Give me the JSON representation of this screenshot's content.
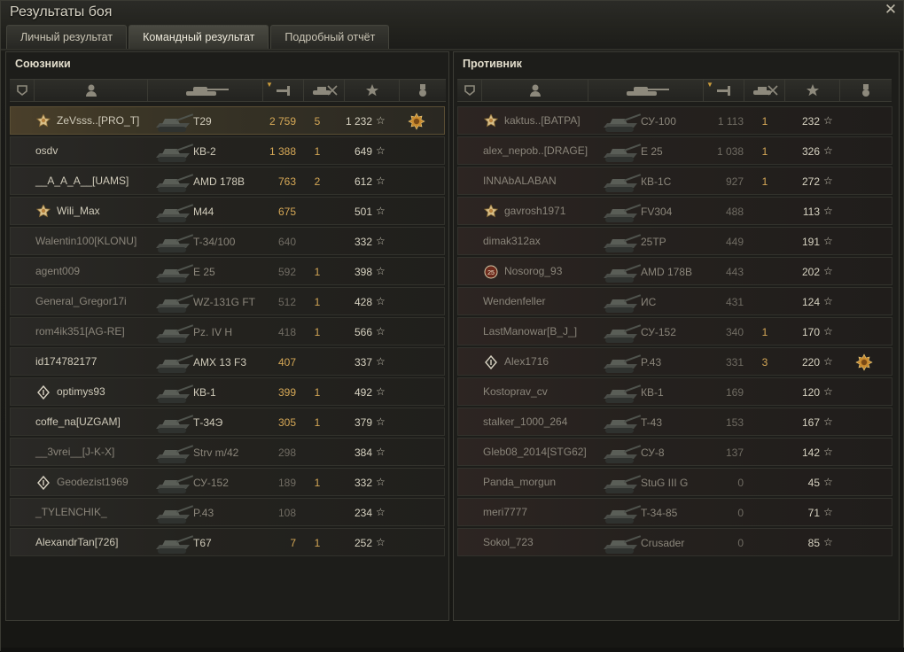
{
  "window": {
    "title": "Результаты боя",
    "close_icon": "close-icon"
  },
  "tabs": [
    {
      "label": "Личный результат",
      "active": false
    },
    {
      "label": "Командный результат",
      "active": true
    },
    {
      "label": "Подробный отчёт",
      "active": false
    }
  ],
  "columns": {
    "icons": [
      "squad-icon",
      "player-icon",
      "tank-icon",
      "damage-icon",
      "kills-icon",
      "experience-icon",
      "medal-icon"
    ]
  },
  "colors": {
    "accent": "#d4a756",
    "ally_row": "#24231f",
    "enemy_row": "#25211e",
    "highlight_row": "#4a3f2a"
  },
  "allies": {
    "title": "Союзники",
    "rows": [
      {
        "player": "ZeVsss..[PRO_T]",
        "tank": "T29",
        "damage": "2 759",
        "kills": "5",
        "xp": "1 232",
        "icon": "master-badge",
        "achievement": "medal",
        "me": true,
        "dead": false
      },
      {
        "player": "osdv",
        "tank": "КВ-2",
        "damage": "1 388",
        "kills": "1",
        "xp": "649",
        "icon": "",
        "achievement": "",
        "me": false,
        "dead": false
      },
      {
        "player": "__A_A_A__[UAMS]",
        "tank": "AMD 178B",
        "damage": "763",
        "kills": "2",
        "xp": "612",
        "icon": "",
        "achievement": "",
        "me": false,
        "dead": false
      },
      {
        "player": "Wili_Max",
        "tank": "M44",
        "damage": "675",
        "kills": "",
        "xp": "501",
        "icon": "master-badge",
        "achievement": "",
        "me": false,
        "dead": false
      },
      {
        "player": "Walentin100[KLONU]",
        "tank": "T-34/100",
        "damage": "640",
        "kills": "",
        "xp": "332",
        "icon": "",
        "achievement": "",
        "me": false,
        "dead": true
      },
      {
        "player": "agent009",
        "tank": "E 25",
        "damage": "592",
        "kills": "1",
        "xp": "398",
        "icon": "",
        "achievement": "",
        "me": false,
        "dead": true
      },
      {
        "player": "General_Gregor17i",
        "tank": "WZ-131G FT",
        "damage": "512",
        "kills": "1",
        "xp": "428",
        "icon": "",
        "achievement": "",
        "me": false,
        "dead": true
      },
      {
        "player": "rom4ik351[AG-RE]",
        "tank": "Pz. IV H",
        "damage": "418",
        "kills": "1",
        "xp": "566",
        "icon": "",
        "achievement": "",
        "me": false,
        "dead": true
      },
      {
        "player": "id174782177",
        "tank": "AMX 13 F3",
        "damage": "407",
        "kills": "",
        "xp": "337",
        "icon": "",
        "achievement": "",
        "me": false,
        "dead": false
      },
      {
        "player": "optimys93",
        "tank": "КВ-1",
        "damage": "399",
        "kills": "1",
        "xp": "492",
        "icon": "class-badge",
        "achievement": "",
        "me": false,
        "dead": false
      },
      {
        "player": "coffe_na[UZGAM]",
        "tank": "Т-34Э",
        "damage": "305",
        "kills": "1",
        "xp": "379",
        "icon": "",
        "achievement": "",
        "me": false,
        "dead": false
      },
      {
        "player": "__3vrei__[J-K-X]",
        "tank": "Strv m/42",
        "damage": "298",
        "kills": "",
        "xp": "384",
        "icon": "",
        "achievement": "",
        "me": false,
        "dead": true
      },
      {
        "player": "Geodezist1969",
        "tank": "СУ-152",
        "damage": "189",
        "kills": "1",
        "xp": "332",
        "icon": "class-badge",
        "achievement": "",
        "me": false,
        "dead": true
      },
      {
        "player": "_TYLENCHIK_",
        "tank": "P.43",
        "damage": "108",
        "kills": "",
        "xp": "234",
        "icon": "",
        "achievement": "",
        "me": false,
        "dead": true
      },
      {
        "player": "AlexandrTan[726]",
        "tank": "T67",
        "damage": "7",
        "kills": "1",
        "xp": "252",
        "icon": "",
        "achievement": "",
        "me": false,
        "dead": false
      }
    ]
  },
  "enemies": {
    "title": "Противник",
    "rows": [
      {
        "player": "kaktus..[BATPA]",
        "tank": "СУ-100",
        "damage": "1 113",
        "kills": "1",
        "xp": "232",
        "icon": "master-badge",
        "achievement": "",
        "me": false,
        "dead": true
      },
      {
        "player": "alex_nepob..[DRAGE]",
        "tank": "E 25",
        "damage": "1 038",
        "kills": "1",
        "xp": "326",
        "icon": "",
        "achievement": "",
        "me": false,
        "dead": true
      },
      {
        "player": "INNAbALABAN",
        "tank": "КВ-1С",
        "damage": "927",
        "kills": "1",
        "xp": "272",
        "icon": "",
        "achievement": "",
        "me": false,
        "dead": true
      },
      {
        "player": "gavrosh1971",
        "tank": "FV304",
        "damage": "488",
        "kills": "",
        "xp": "113",
        "icon": "master-badge",
        "achievement": "",
        "me": false,
        "dead": true
      },
      {
        "player": "dimak312ax",
        "tank": "25TP",
        "damage": "449",
        "kills": "",
        "xp": "191",
        "icon": "",
        "achievement": "",
        "me": false,
        "dead": true
      },
      {
        "player": "Nosorog_93",
        "tank": "AMD 178B",
        "damage": "443",
        "kills": "",
        "xp": "202",
        "icon": "rank-badge",
        "achievement": "",
        "me": false,
        "dead": true
      },
      {
        "player": "Wendenfeller",
        "tank": "ИС",
        "damage": "431",
        "kills": "",
        "xp": "124",
        "icon": "",
        "achievement": "",
        "me": false,
        "dead": true
      },
      {
        "player": "LastManowar[B_J_]",
        "tank": "СУ-152",
        "damage": "340",
        "kills": "1",
        "xp": "170",
        "icon": "",
        "achievement": "",
        "me": false,
        "dead": true
      },
      {
        "player": "Alex1716",
        "tank": "P.43",
        "damage": "331",
        "kills": "3",
        "xp": "220",
        "icon": "class-badge",
        "achievement": "medal",
        "me": false,
        "dead": true
      },
      {
        "player": "Kostoprav_cv",
        "tank": "КВ-1",
        "damage": "169",
        "kills": "",
        "xp": "120",
        "icon": "",
        "achievement": "",
        "me": false,
        "dead": true
      },
      {
        "player": "stalker_1000_264",
        "tank": "T-43",
        "damage": "153",
        "kills": "",
        "xp": "167",
        "icon": "",
        "achievement": "",
        "me": false,
        "dead": true
      },
      {
        "player": "Gleb08_2014[STG62]",
        "tank": "СУ-8",
        "damage": "137",
        "kills": "",
        "xp": "142",
        "icon": "",
        "achievement": "",
        "me": false,
        "dead": true
      },
      {
        "player": "Panda_morgun",
        "tank": "StuG III G",
        "damage": "0",
        "kills": "",
        "xp": "45",
        "icon": "",
        "achievement": "",
        "me": false,
        "dead": true
      },
      {
        "player": "meri7777",
        "tank": "T-34-85",
        "damage": "0",
        "kills": "",
        "xp": "71",
        "icon": "",
        "achievement": "",
        "me": false,
        "dead": true
      },
      {
        "player": "Sokol_723",
        "tank": "Crusader",
        "damage": "0",
        "kills": "",
        "xp": "85",
        "icon": "",
        "achievement": "",
        "me": false,
        "dead": true
      }
    ]
  }
}
